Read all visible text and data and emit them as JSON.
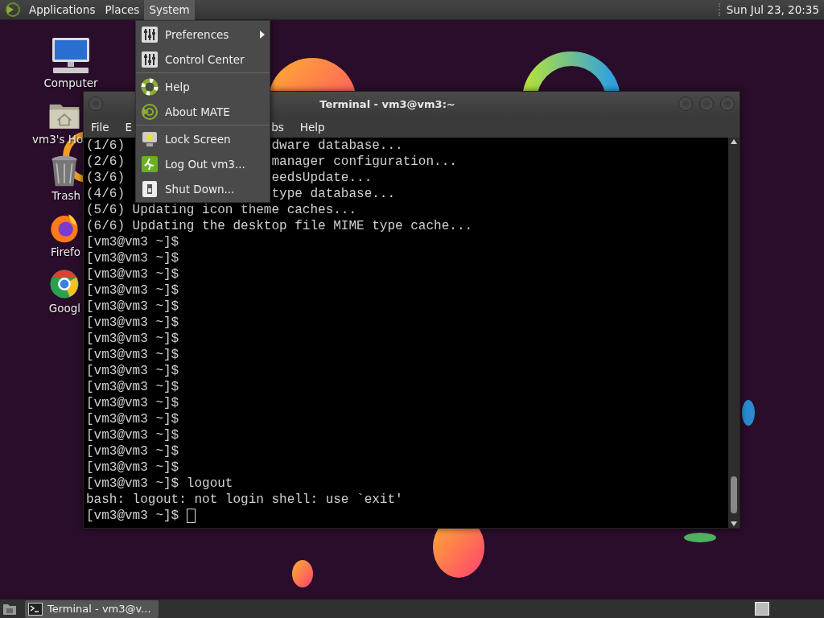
{
  "top_panel": {
    "menus": [
      {
        "label": "Applications",
        "selected": false
      },
      {
        "label": "Places",
        "selected": false
      },
      {
        "label": "System",
        "selected": true
      }
    ],
    "clock": "Sun Jul 23, 20:35"
  },
  "desktop_icons": [
    {
      "label": "Computer",
      "kind": "computer"
    },
    {
      "label": "vm3's Ho",
      "kind": "home"
    },
    {
      "label": "Trash",
      "kind": "trash"
    },
    {
      "label": "Firefo",
      "kind": "firefox"
    },
    {
      "label": "Googl",
      "kind": "chrome"
    }
  ],
  "system_menu": {
    "sections": [
      [
        {
          "label": "Preferences",
          "kind": "preferences",
          "submenu": true
        },
        {
          "label": "Control Center",
          "kind": "preferences",
          "submenu": false
        }
      ],
      [
        {
          "label": "Help",
          "kind": "help",
          "submenu": false
        },
        {
          "label": "About MATE",
          "kind": "about",
          "submenu": false
        }
      ],
      [
        {
          "label": "Lock Screen",
          "kind": "lock",
          "submenu": false
        },
        {
          "label": "Log Out vm3...",
          "kind": "logout",
          "submenu": false
        },
        {
          "label": "Shut Down...",
          "kind": "shutdown",
          "submenu": false
        }
      ]
    ]
  },
  "terminal": {
    "title": "Terminal - vm3@vm3:~",
    "menu": [
      "File",
      "E",
      "bs",
      "Help"
    ],
    "lines": [
      {
        "left": "(1/6)",
        "right": "dware database..."
      },
      {
        "left": "(2/6)",
        "right": "manager configuration..."
      },
      {
        "left": "(3/6)",
        "right": "eedsUpdate..."
      },
      {
        "left": "(4/6)",
        "right": "type database..."
      },
      {
        "text": "(5/6) Updating icon theme caches..."
      },
      {
        "text": "(6/6) Updating the desktop file MIME type cache..."
      },
      {
        "text": "[vm3@vm3 ~]$"
      },
      {
        "text": "[vm3@vm3 ~]$"
      },
      {
        "text": "[vm3@vm3 ~]$"
      },
      {
        "text": "[vm3@vm3 ~]$"
      },
      {
        "text": "[vm3@vm3 ~]$"
      },
      {
        "text": "[vm3@vm3 ~]$"
      },
      {
        "text": "[vm3@vm3 ~]$"
      },
      {
        "text": "[vm3@vm3 ~]$"
      },
      {
        "text": "[vm3@vm3 ~]$"
      },
      {
        "text": "[vm3@vm3 ~]$"
      },
      {
        "text": "[vm3@vm3 ~]$"
      },
      {
        "text": "[vm3@vm3 ~]$"
      },
      {
        "text": "[vm3@vm3 ~]$"
      },
      {
        "text": "[vm3@vm3 ~]$"
      },
      {
        "text": "[vm3@vm3 ~]$"
      },
      {
        "text": "[vm3@vm3 ~]$ logout"
      },
      {
        "text": "bash: logout: not login shell: use `exit'"
      },
      {
        "text": "[vm3@vm3 ~]$",
        "cursor": true
      }
    ]
  },
  "taskbar": {
    "tasks": [
      {
        "label": "Terminal - vm3@v...",
        "selected": true
      }
    ]
  }
}
